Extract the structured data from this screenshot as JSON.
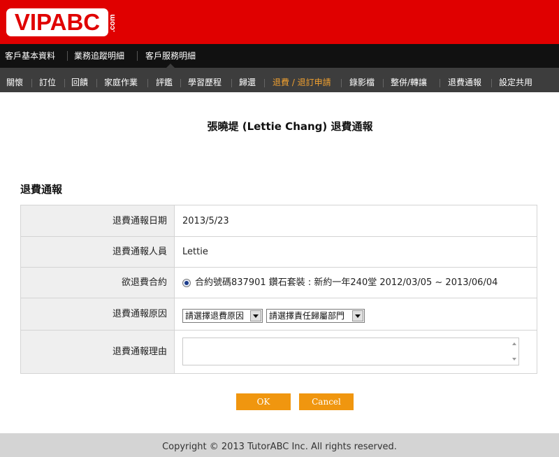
{
  "logo": {
    "text": "VIPABC",
    "suffix": ".com"
  },
  "nav_primary": {
    "items": [
      "客戶基本資料",
      "業務追蹤明細",
      "客戶服務明細"
    ]
  },
  "nav_secondary": {
    "items": [
      "關懷",
      "訂位",
      "回饋",
      "家庭作業",
      "評鑑",
      "學習歷程",
      "歸還",
      "退費 / 退訂申請",
      "錄影檔",
      "整併/轉讓",
      "退費通報",
      "設定共用"
    ],
    "active_index": 7
  },
  "page_title": "張曉堤 (Lettie Chang) 退費通報",
  "section_title": "退費通報",
  "form": {
    "date_label": "退費通報日期",
    "date_value": "2013/5/23",
    "staff_label": "退費通報人員",
    "staff_value": "Lettie",
    "contract_label": "欲退費合約",
    "contract_value": "合約號碼837901 鑽石套裝 : 新約一年240堂 2012/03/05 ~ 2013/06/04",
    "reason_label": "退費通報原因",
    "reason_select": "請選擇退費原因",
    "dept_select": "請選擇責任歸屬部門",
    "explanation_label": "退費通報理由",
    "explanation_value": ""
  },
  "buttons": {
    "ok": "OK",
    "cancel": "Cancel"
  },
  "footer": "Copyright © 2013 TutorABC Inc. All rights reserved.",
  "colors": {
    "brand_red": "#e00000",
    "accent_orange": "#f0960f",
    "active_nav": "#f0a030"
  }
}
